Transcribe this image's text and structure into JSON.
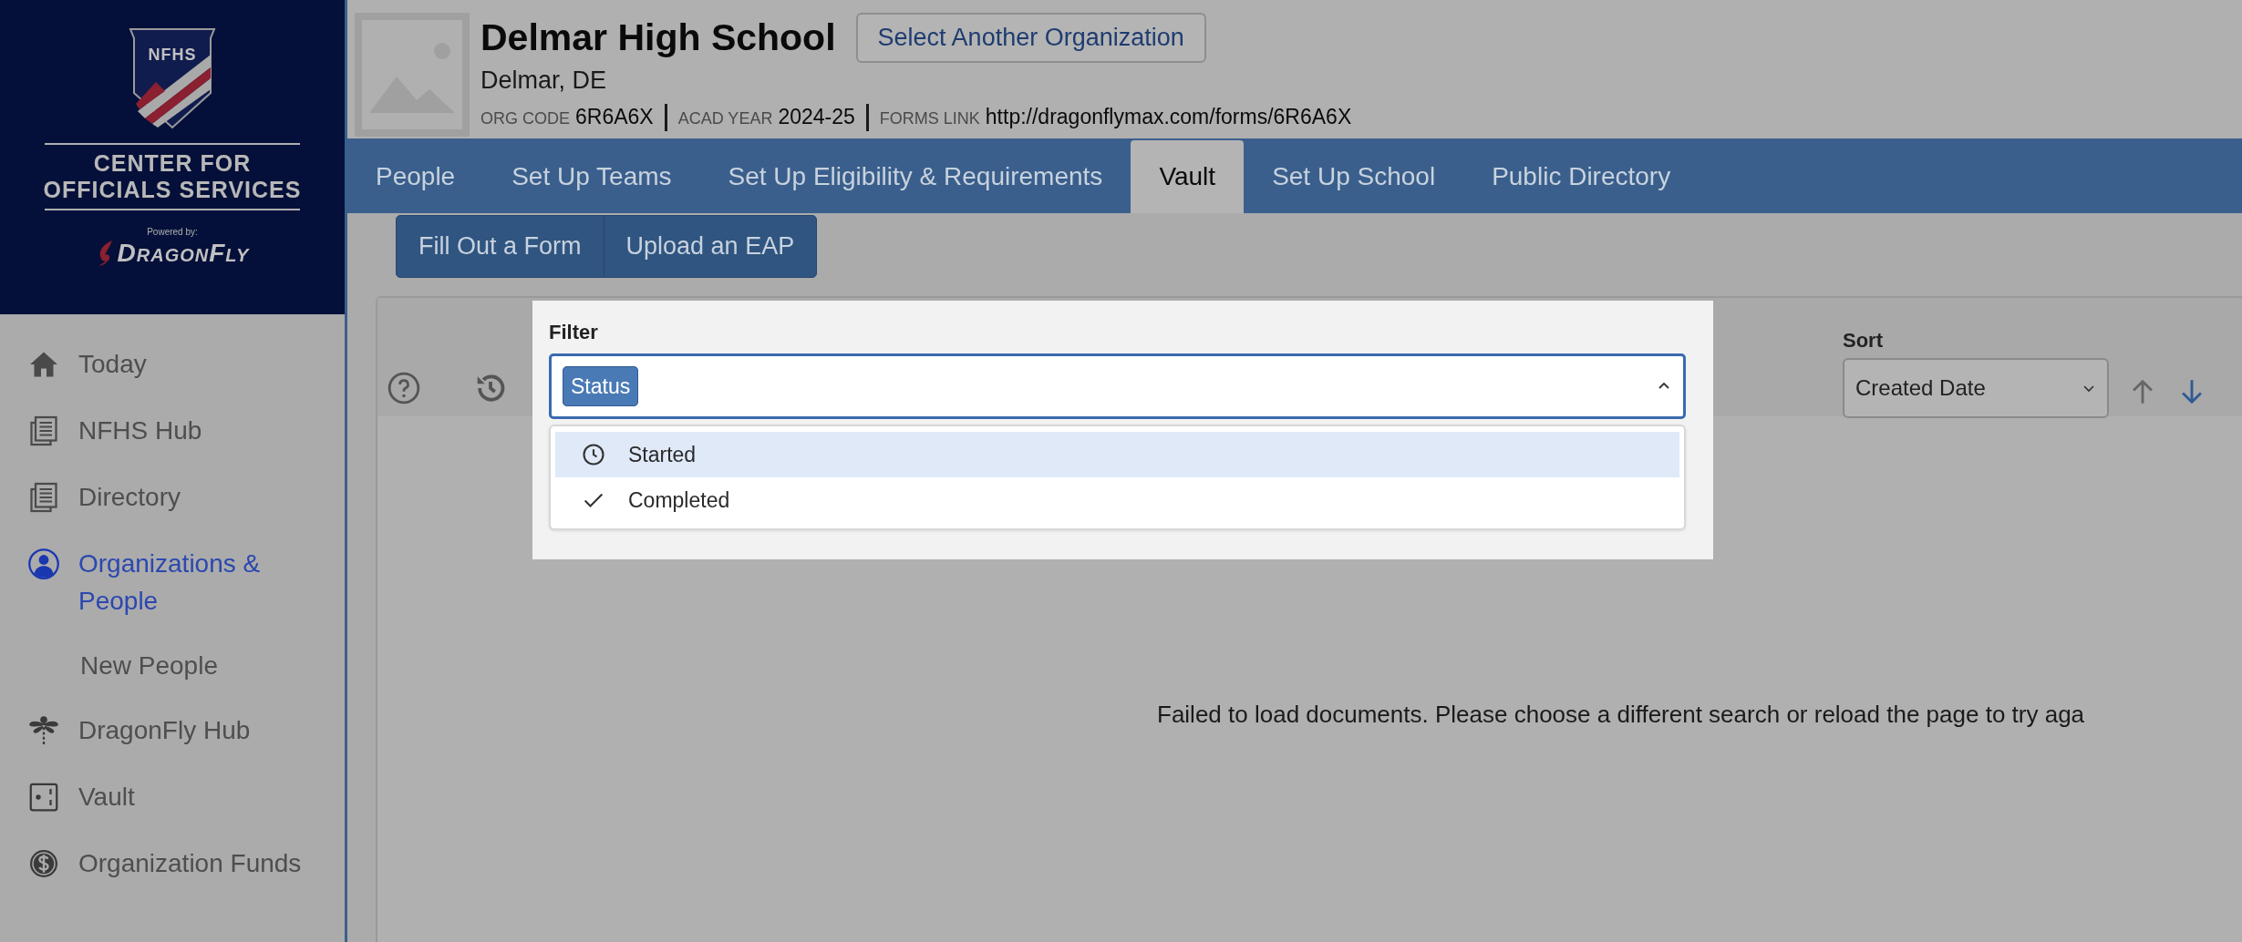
{
  "sidebar": {
    "logo": {
      "mark": "NFHS",
      "title_lines": [
        "CENTER FOR",
        "OFFICIALS SERVICES"
      ],
      "powered_by": "Powered by:",
      "brand": "DragonFly"
    },
    "items": [
      {
        "label": "Today",
        "selected": false
      },
      {
        "label": "NFHS Hub",
        "selected": false
      },
      {
        "label": "Directory",
        "selected": false
      },
      {
        "label": "Organizations & People",
        "selected": true,
        "children": [
          {
            "label": "New People",
            "selected": false
          }
        ]
      },
      {
        "label": "DragonFly Hub",
        "selected": false
      },
      {
        "label": "Vault",
        "selected": false
      },
      {
        "label": "Organization Funds",
        "selected": false
      }
    ]
  },
  "header": {
    "name": "Delmar High School",
    "location": "Delmar, DE",
    "select_button": "Select Another Organization",
    "meta": [
      {
        "label": "ORG CODE",
        "value": "6R6A6X"
      },
      {
        "label": "ACAD YEAR",
        "value": "2024-25"
      },
      {
        "label": "FORMS LINK",
        "value": "http://dragonflymax.com/forms/6R6A6X"
      }
    ]
  },
  "tabs": [
    {
      "label": "People",
      "selected": false
    },
    {
      "label": "Set Up Teams",
      "selected": false
    },
    {
      "label": "Set Up Eligibility & Requirements",
      "selected": false
    },
    {
      "label": "Vault",
      "selected": true
    },
    {
      "label": "Set Up School",
      "selected": false
    },
    {
      "label": "Public Directory",
      "selected": false
    }
  ],
  "actions": [
    "Fill Out a Form",
    "Upload an EAP"
  ],
  "filter": {
    "label": "Filter",
    "chips": [
      "Status"
    ],
    "expanded": true,
    "options": [
      {
        "kind": "clock",
        "label": "Started",
        "selected": true
      },
      {
        "kind": "check",
        "label": "Completed",
        "selected": false
      }
    ]
  },
  "sort": {
    "label": "Sort",
    "value": "Created Date",
    "descending": true
  },
  "message": "Failed to load documents. Please choose a different search or reload the page to try aga"
}
